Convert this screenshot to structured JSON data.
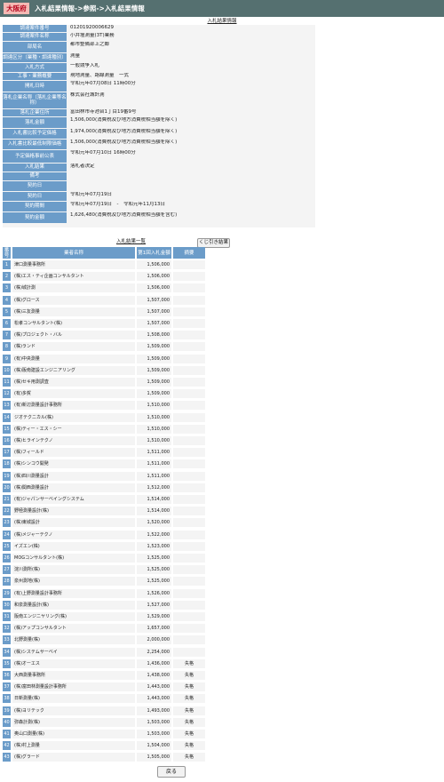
{
  "header": {
    "logo": "大阪府",
    "breadcrumb": "入札結果情報->参照->入札結果情報"
  },
  "info_caption": "入札結果情報",
  "info_rows": [
    {
      "label": "調達案件番号",
      "value": "01201920006629"
    },
    {
      "label": "調達案件名称",
      "value": "小井壇測量(3T)業務"
    },
    {
      "label": "部局名",
      "value": "都市整備部上之郷"
    },
    {
      "label": "調達区分（業種・調達種別）",
      "value": "測量"
    },
    {
      "label": "入札方式",
      "value": "一般競争入札"
    },
    {
      "label": "工事・業務概要",
      "value": "現地測量、路線測量　一式"
    },
    {
      "label": "開札日時",
      "value": "令和元年07月08日 11時00分"
    },
    {
      "label": "落札企業名称（落札企業等名称）",
      "value": "株式会社城計測"
    },
    {
      "label": "落札企業住所",
      "value": "富田林市寺池台1丁目19番9号"
    },
    {
      "label": "落札金額",
      "value": "1,506,000(消費税及び地方消費税相当額を除く)"
    },
    {
      "label": "入札書比較予定価格",
      "value": "1,974,000(消費税及び地方消費税相当額を除く)"
    },
    {
      "label": "入札書比較最低制限価格",
      "value": "1,506,000(消費税及び地方消費税相当額を除く)"
    },
    {
      "label": "予定価格事前公表",
      "value": "令和元年07月10日 16時00分"
    },
    {
      "label": "入札結果",
      "value": "落札者決定"
    },
    {
      "label": "備考",
      "value": ""
    },
    {
      "label": "契約日",
      "value": ""
    },
    {
      "label": "契約日",
      "value": "令和元年07月19日"
    },
    {
      "label": "契約期間",
      "value": "令和元年07月19日　-　令和元年11月13日"
    },
    {
      "label": "契約金額",
      "value": "1,626,480(消費税及び地方消費税相当額を含む)"
    }
  ],
  "bid_list": {
    "caption": "入札結果一覧",
    "lottery_button": "くじ引き結果",
    "headers": {
      "no": "番号",
      "name": "業者名称",
      "amount": "第1回入札金額",
      "note": "摘要"
    },
    "rows": [
      {
        "no": "1",
        "name": "津口測量事務所",
        "amount": "1,506,000",
        "note": ""
      },
      {
        "no": "2",
        "name": "(株)エス・ティ企画コンサルタント",
        "amount": "1,506,000",
        "note": ""
      },
      {
        "no": "3",
        "name": "(株)城計測",
        "amount": "1,506,000",
        "note": ""
      },
      {
        "no": "4",
        "name": "(株)グロース",
        "amount": "1,507,000",
        "note": ""
      },
      {
        "no": "5",
        "name": "(株)三友測量",
        "amount": "1,507,000",
        "note": ""
      },
      {
        "no": "6",
        "name": "松孝コンサルタント(株)",
        "amount": "1,507,000",
        "note": ""
      },
      {
        "no": "7",
        "name": "(株)プロジェクト・バル",
        "amount": "1,508,000",
        "note": ""
      },
      {
        "no": "8",
        "name": "(株)ランド",
        "amount": "1,509,000",
        "note": ""
      },
      {
        "no": "9",
        "name": "(有)中央測量",
        "amount": "1,509,000",
        "note": ""
      },
      {
        "no": "10",
        "name": "(株)阪南建設エンジニアリング",
        "amount": "1,509,000",
        "note": ""
      },
      {
        "no": "11",
        "name": "(株)セキ用測調査",
        "amount": "1,509,000",
        "note": ""
      },
      {
        "no": "12",
        "name": "(有)多賀",
        "amount": "1,509,000",
        "note": ""
      },
      {
        "no": "13",
        "name": "(有)新辺測量設計事務所",
        "amount": "1,510,000",
        "note": ""
      },
      {
        "no": "14",
        "name": "ジオテクニカル(株)",
        "amount": "1,510,000",
        "note": ""
      },
      {
        "no": "15",
        "name": "(株)ティー・エス・シー",
        "amount": "1,510,000",
        "note": ""
      },
      {
        "no": "16",
        "name": "(株)ヒラインテクノ",
        "amount": "1,510,000",
        "note": ""
      },
      {
        "no": "17",
        "name": "(株)フィールド",
        "amount": "1,511,000",
        "note": ""
      },
      {
        "no": "18",
        "name": "(株)シンコウ開発",
        "amount": "1,511,000",
        "note": ""
      },
      {
        "no": "19",
        "name": "(株)四川測量設計",
        "amount": "1,511,000",
        "note": ""
      },
      {
        "no": "20",
        "name": "(株)関西測量設計",
        "amount": "1,512,000",
        "note": ""
      },
      {
        "no": "21",
        "name": "(有)ジャパンサーベイングシステム",
        "amount": "1,514,000",
        "note": ""
      },
      {
        "no": "22",
        "name": "野極測量設計(株)",
        "amount": "1,514,000",
        "note": ""
      },
      {
        "no": "23",
        "name": "(株)東城設計",
        "amount": "1,520,000",
        "note": ""
      },
      {
        "no": "24",
        "name": "(株)メジャーテクノ",
        "amount": "1,522,000",
        "note": ""
      },
      {
        "no": "25",
        "name": "イズエン(株)",
        "amount": "1,523,000",
        "note": ""
      },
      {
        "no": "26",
        "name": "MOGコンサルタント(株)",
        "amount": "1,525,000",
        "note": ""
      },
      {
        "no": "27",
        "name": "淀川測所(株)",
        "amount": "1,525,000",
        "note": ""
      },
      {
        "no": "28",
        "name": "泉州測地(株)",
        "amount": "1,525,000",
        "note": ""
      },
      {
        "no": "29",
        "name": "(有)上野測量設計事務所",
        "amount": "1,526,000",
        "note": ""
      },
      {
        "no": "30",
        "name": "和泉測量設計(株)",
        "amount": "1,527,000",
        "note": ""
      },
      {
        "no": "31",
        "name": "阪南エンジニヤリング(株)",
        "amount": "1,529,000",
        "note": ""
      },
      {
        "no": "32",
        "name": "(株)アップコンサルタント",
        "amount": "1,657,000",
        "note": ""
      },
      {
        "no": "33",
        "name": "北野測量(株)",
        "amount": "2,000,000",
        "note": ""
      },
      {
        "no": "34",
        "name": "(株)システムサーベイ",
        "amount": "2,254,000",
        "note": ""
      },
      {
        "no": "35",
        "name": "(株)オーエス",
        "amount": "1,436,000",
        "note": "失格"
      },
      {
        "no": "36",
        "name": "大西測量事務所",
        "amount": "1,438,000",
        "note": "失格"
      },
      {
        "no": "37",
        "name": "(株)富田林測量設計事務所",
        "amount": "1,443,000",
        "note": "失格"
      },
      {
        "no": "38",
        "name": "日新測量(株)",
        "amount": "1,443,000",
        "note": "失格"
      },
      {
        "no": "39",
        "name": "(株)ヨリテック",
        "amount": "1,493,000",
        "note": "失格"
      },
      {
        "no": "40",
        "name": "弥森計測(株)",
        "amount": "1,503,000",
        "note": "失格"
      },
      {
        "no": "41",
        "name": "奥山口測量(株)",
        "amount": "1,503,000",
        "note": "失格"
      },
      {
        "no": "42",
        "name": "(株)村上測量",
        "amount": "1,504,000",
        "note": "失格"
      },
      {
        "no": "43",
        "name": "(株)グラード",
        "amount": "1,505,000",
        "note": "失格"
      }
    ]
  },
  "footer": {
    "back_button": "戻る"
  }
}
